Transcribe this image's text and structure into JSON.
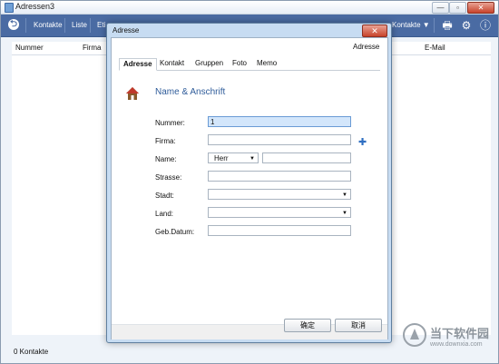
{
  "window": {
    "title": "Adressen3",
    "min_glyph": "—",
    "max_glyph": "▫",
    "close_glyph": "✕"
  },
  "toolbar": {
    "back_glyph": "⮌",
    "items": [
      "Kontakte",
      "Liste",
      "Eti"
    ],
    "right_dropdown": "Kontakte ▼",
    "print_glyph": "🖶",
    "gear_glyph": "⚙",
    "info_glyph": "ⓘ"
  },
  "grid": {
    "columns": [
      "Nummer",
      "Firma",
      "E-Mail"
    ]
  },
  "status": {
    "count_text": "0 Kontakte"
  },
  "dialog": {
    "title": "Adresse",
    "close_glyph": "✕",
    "header_label": "Adresse",
    "tabs": [
      "Adresse",
      "Kontakt",
      "Gruppen",
      "Foto",
      "Memo"
    ],
    "section_title": "Name & Anschrift",
    "fields": {
      "nummer_label": "Nummer:",
      "nummer_value": "1",
      "firma_label": "Firma:",
      "firma_value": "",
      "name_label": "Name:",
      "anrede_value": "Herr",
      "name_value": "",
      "strasse_label": "Strasse:",
      "strasse_value": "",
      "stadt_label": "Stadt:",
      "stadt_value": "",
      "land_label": "Land:",
      "land_value": "",
      "gebdatum_label": "Geb.Datum:",
      "gebdatum_value": ""
    },
    "add_glyph": "✚",
    "dropdown_glyph": "▼",
    "ok_label": "确定",
    "cancel_label": "取消"
  },
  "watermark": {
    "brand": "当下软件园",
    "url": "www.downxia.com"
  },
  "colors": {
    "toolbar": "#4a6ba3",
    "accent": "#2f5c9a",
    "focus": "#d3e6fb"
  }
}
